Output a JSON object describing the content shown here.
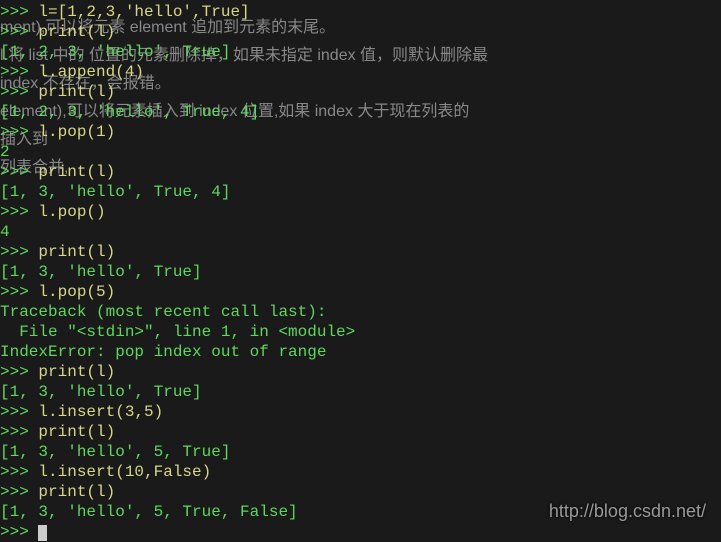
{
  "background_text": {
    "line1": "ment),可以将元素 element 追加到元素的末尾。",
    "line2_a": "l.将 list 中的     位置的元素删除掉，如果未指定 index 值，则默认删除最",
    "line2_b": "index 不存在，会报错。",
    "line3_a": "element),可以将元素插入到 index 位置,如果 index 大于现在列表的",
    "line3_b": "插入到",
    "line4": "列表合并,"
  },
  "terminal": {
    "prompt": ">>> ",
    "lines": [
      {
        "type": "in",
        "text": "l=[1,2,3,'hello',True]"
      },
      {
        "type": "in",
        "text": "print(l)"
      },
      {
        "type": "out",
        "text": "[1, 2, 3, 'hello', True]"
      },
      {
        "type": "in",
        "text": "l.append(4)"
      },
      {
        "type": "in",
        "text": "print(l)"
      },
      {
        "type": "out",
        "text": "[1, 2, 3, 'hello', True, 4]"
      },
      {
        "type": "in",
        "text": "l.pop(1)"
      },
      {
        "type": "out",
        "text": "2"
      },
      {
        "type": "in",
        "text": "print(l)"
      },
      {
        "type": "out",
        "text": "[1, 3, 'hello', True, 4]"
      },
      {
        "type": "in",
        "text": "l.pop()"
      },
      {
        "type": "out",
        "text": "4"
      },
      {
        "type": "in",
        "text": "print(l)"
      },
      {
        "type": "out",
        "text": "[1, 3, 'hello', True]"
      },
      {
        "type": "in",
        "text": "l.pop(5)"
      },
      {
        "type": "tb",
        "text": "Traceback (most recent call last):"
      },
      {
        "type": "tb",
        "text": "  File \"<stdin>\", line 1, in <module>"
      },
      {
        "type": "tb",
        "text": "IndexError: pop index out of range"
      },
      {
        "type": "in",
        "text": "print(l)"
      },
      {
        "type": "out",
        "text": "[1, 3, 'hello', True]"
      },
      {
        "type": "in",
        "text": "l.insert(3,5)"
      },
      {
        "type": "in",
        "text": "print(l)"
      },
      {
        "type": "out",
        "text": "[1, 3, 'hello', 5, True]"
      },
      {
        "type": "in",
        "text": "l.insert(10,False)"
      },
      {
        "type": "in",
        "text": "print(l)"
      },
      {
        "type": "out",
        "text": "[1, 3, 'hello', 5, True, False]"
      },
      {
        "type": "cursor",
        "text": ""
      }
    ]
  },
  "watermark": "http://blog.csdn.net/"
}
